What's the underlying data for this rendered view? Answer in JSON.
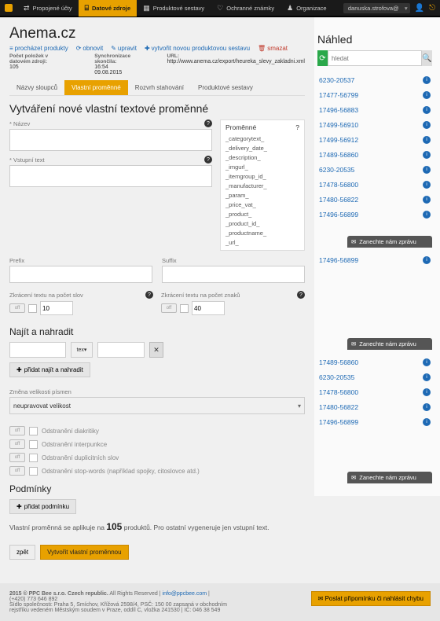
{
  "nav": {
    "items": [
      "Propojené účty",
      "Datové zdroje",
      "Produktové sestavy",
      "Ochranné známky",
      "Organizace"
    ],
    "user": "danuska.strofova@"
  },
  "page": {
    "title": "Anema.cz"
  },
  "toolbar": {
    "browse": "procházet produkty",
    "refresh": "obnovit",
    "edit": "upravit",
    "create": "vytvořit novou produktovou sestavu",
    "delete": "smazat"
  },
  "meta": {
    "count_lbl": "Počet položek v datovém zdroji:",
    "count": "105",
    "sync_lbl": "Synchronizace skončila:",
    "sync": "16:54 09.08.2015",
    "url_lbl": "URL:",
    "url": "http://www.anema.cz/export/heureka_slevy_zakladni.xml"
  },
  "tabs": [
    "Názvy sloupců",
    "Vlastní proměnné",
    "Rozvrh stahování",
    "Produktové sestavy"
  ],
  "h2": "Vytváření nové vlastní textové proměnné",
  "labels": {
    "name": "* Název",
    "input": "* Vstupní text",
    "prefix": "Prefix",
    "suffix": "Suffix",
    "trim_words": "Zkrácení textu na počet slov",
    "trim_chars": "Zkrácení textu na počet znaků"
  },
  "defaults": {
    "words": "10",
    "chars": "40"
  },
  "vars": {
    "title": "Proměnné",
    "items": [
      "_categorytext_",
      "_delivery_date_",
      "_description_",
      "_imgurl_",
      "_itemgroup_id_",
      "_manufacturer_",
      "_param_",
      "_price_vat_",
      "_product_",
      "_product_id_",
      "_productname_",
      "_url_"
    ]
  },
  "find": {
    "h": "Najít a nahradit",
    "sel": "tex",
    "add": "přidat najít a nahradit"
  },
  "case": {
    "lbl": "Změna velikosti písmen",
    "val": "neupravovat velikost"
  },
  "opts": [
    "Odstranění diakritiky",
    "Odstranění interpunkce",
    "Odstranění duplicitních slov",
    "Odstranění stop-words (například spojky, citoslovce atd.)"
  ],
  "cond": {
    "h": "Podmínky",
    "add": "přidat podmínku"
  },
  "note": {
    "a": "Vlastní proměnná se aplikuje na ",
    "n": "105",
    "b": " produktů. Pro ostatní vygeneruje jen vstupní text."
  },
  "actions": {
    "back": "zpět",
    "submit": "Vytvořit vlastní proměnnou"
  },
  "side": {
    "h": "Náhled",
    "ph": "hledat",
    "list1": [
      "6230-20537",
      "17477-56799",
      "17496-56883",
      "17499-56910",
      "17499-56912",
      "17489-56860",
      "6230-20535",
      "17478-56800",
      "17480-56822",
      "17496-56899"
    ],
    "list2": [
      "17496-56899"
    ],
    "list3": [
      "17489-56860",
      "6230-20535",
      "17478-56800",
      "17480-56822",
      "17496-56899"
    ],
    "msg": "Zanechte nám zprávu"
  },
  "footer": {
    "c": "2015 © PPC Bee s.r.o. Czech republic.",
    "r": " All Rights Reserved | ",
    "l": "info@ppcbee.com",
    "p": "(+420) 773 646 892",
    "a": "Sídlo společnosti: Praha 5, Smíchov, Křížová 2598/4, PSČ: 150 00 zapsaná v obchodním rejstříku vedeném Městským soudem v Praze, oddíl C, vložka 241530 | IČ: 046 38 549",
    "btn": "Poslat připomínku či nahlásit chybu"
  }
}
